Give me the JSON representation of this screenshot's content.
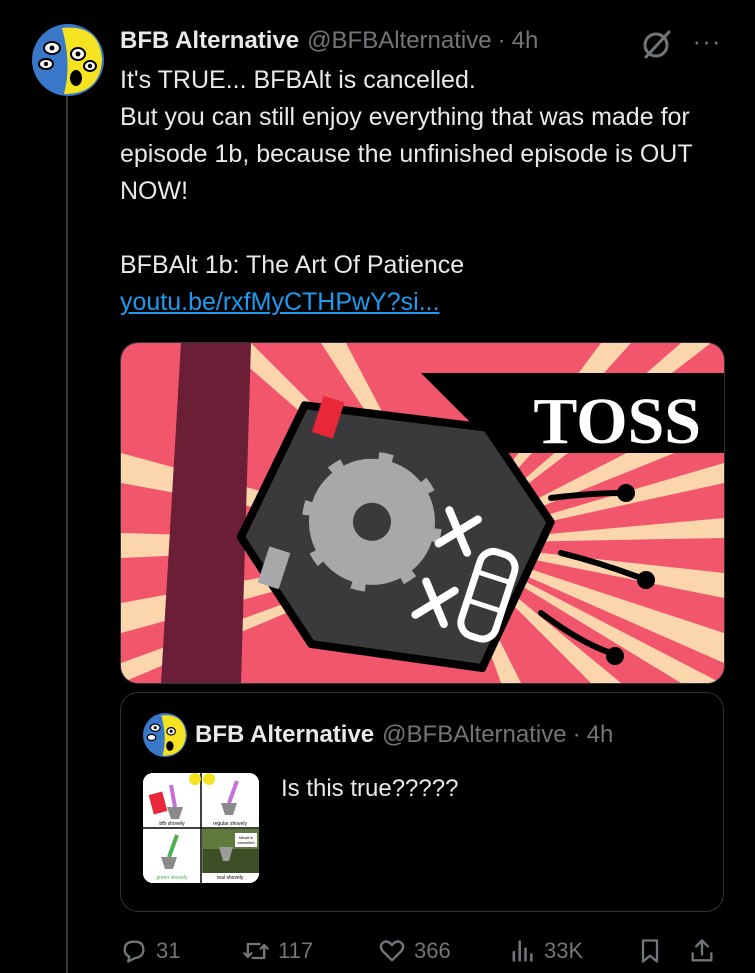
{
  "tweet": {
    "display_name": "BFB Alternative",
    "handle": "@BFBAlternative",
    "separator": "·",
    "time": "4h",
    "more_label": "···",
    "text_lines": [
      "It's TRUE... BFBAlt is cancelled.",
      "But you can still enjoy everything that was made for episode 1b, because the unfinished episode is OUT NOW!",
      "BFBAlt 1b: The Art Of Patience"
    ],
    "link_text": "youtu.be/rxfMyCTHPwY?si...",
    "media": {
      "banner_text": "TOSS",
      "colors": {
        "background": "#f2566d",
        "rays": "#fbd6ad",
        "stripe": "#6b1f36",
        "body": "#3a3a3c",
        "face": "#a8a8aa"
      }
    }
  },
  "quote": {
    "display_name": "BFB Alternative",
    "handle": "@BFBAlternative",
    "separator": "·",
    "time": "4h",
    "text": "Is this true?????",
    "thumb_captions": [
      "bfb shovely",
      "regular shovely",
      "green shovely",
      "real shovely"
    ],
    "thumb_overlay": "bfbalt is cancelled"
  },
  "actions": {
    "replies": "31",
    "reposts": "117",
    "likes": "366",
    "views": "33K"
  },
  "colors": {
    "background": "#000000",
    "text": "#e7e9ea",
    "muted": "#71767b",
    "link": "#1d9bf0",
    "border": "#2f3336"
  }
}
